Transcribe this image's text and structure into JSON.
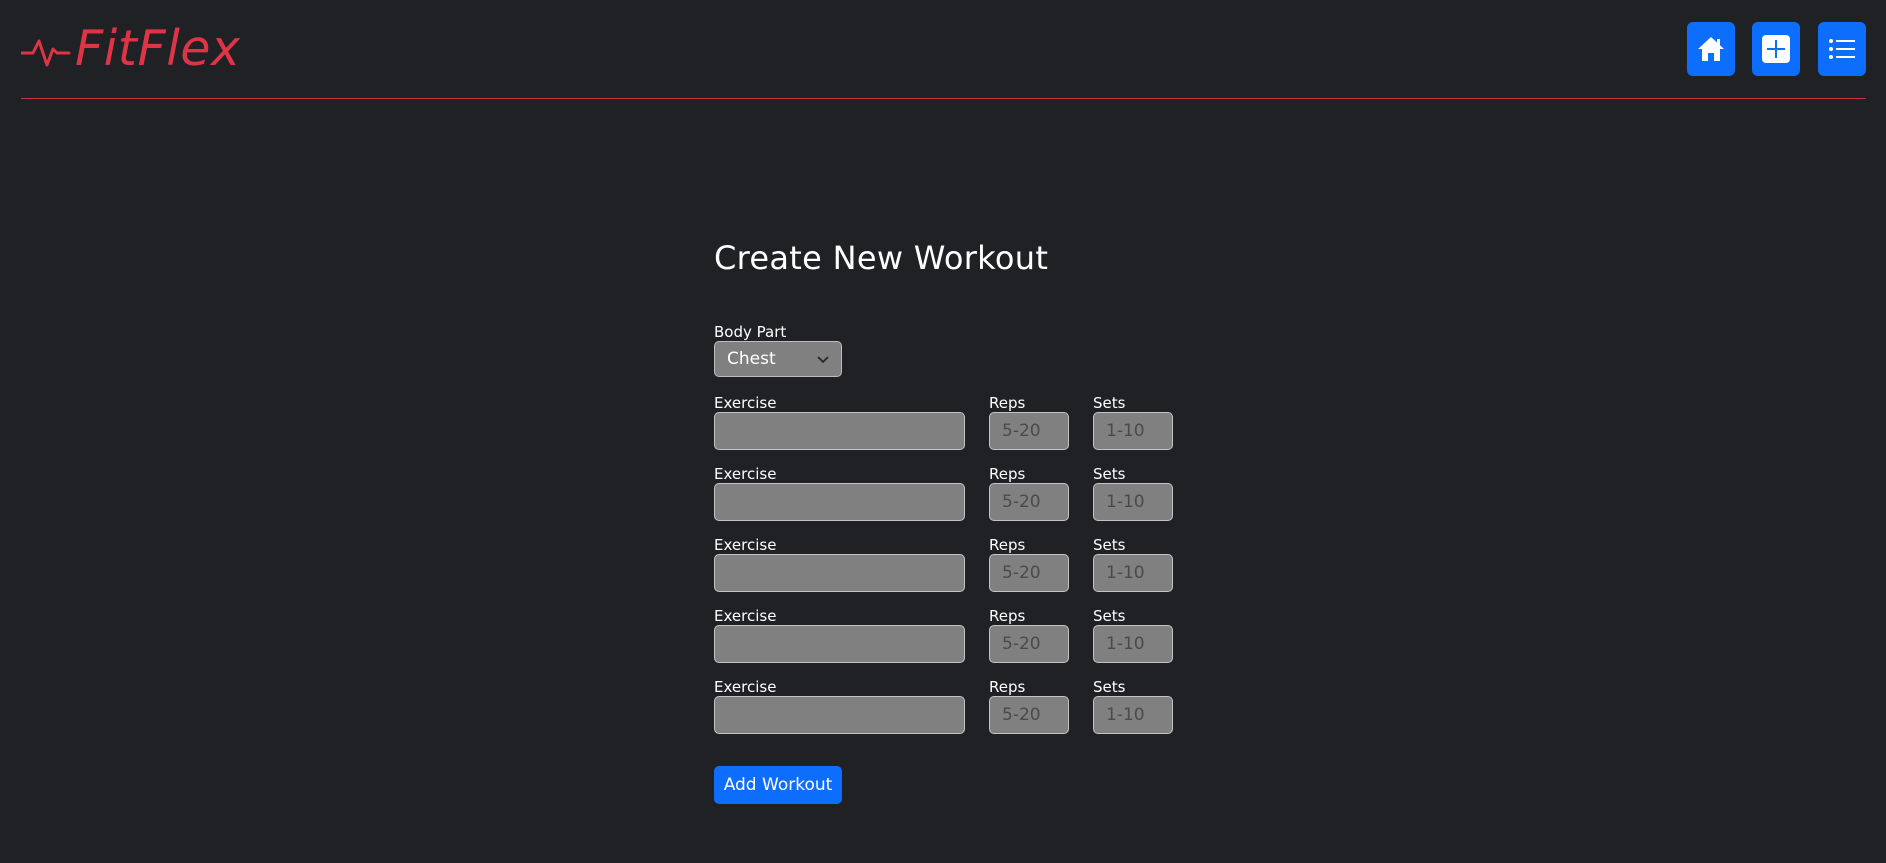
{
  "brand": {
    "name": "FitFlex",
    "color": "#dc3545"
  },
  "nav": {
    "buttons": [
      {
        "icon": "home-icon"
      },
      {
        "icon": "plus-icon"
      },
      {
        "icon": "list-icon"
      }
    ],
    "accent": "#0d6efd"
  },
  "form": {
    "title": "Create New Workout",
    "body_part": {
      "label": "Body Part",
      "value": "Chest"
    },
    "exercise_label": "Exercise",
    "reps_label": "Reps",
    "sets_label": "Sets",
    "rows": [
      {
        "exercise": "",
        "reps_placeholder": "5-20",
        "sets_placeholder": "1-10"
      },
      {
        "exercise": "",
        "reps_placeholder": "5-20",
        "sets_placeholder": "1-10"
      },
      {
        "exercise": "",
        "reps_placeholder": "5-20",
        "sets_placeholder": "1-10"
      },
      {
        "exercise": "",
        "reps_placeholder": "5-20",
        "sets_placeholder": "1-10"
      },
      {
        "exercise": "",
        "reps_placeholder": "5-20",
        "sets_placeholder": "1-10"
      }
    ],
    "submit_label": "Add Workout"
  }
}
